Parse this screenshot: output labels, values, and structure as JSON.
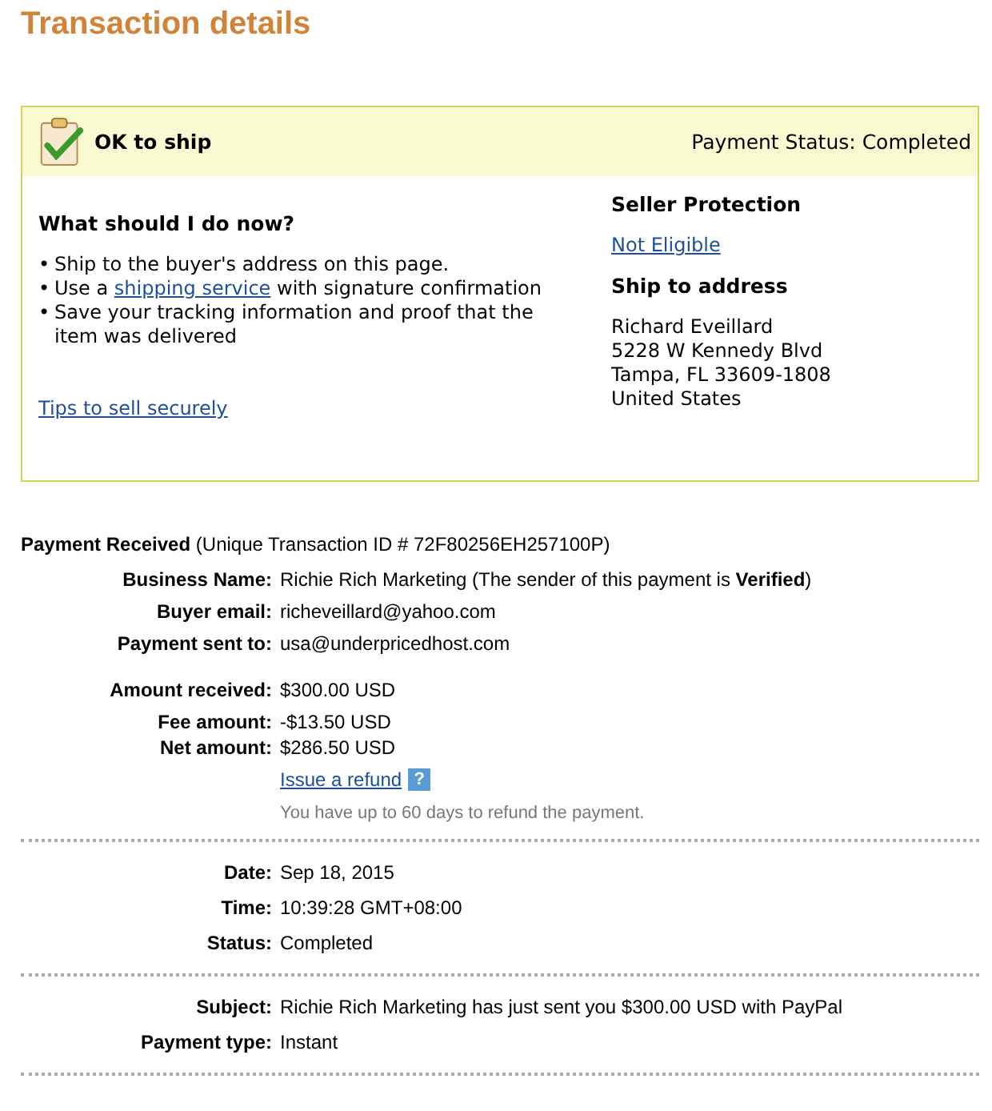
{
  "title": "Transaction details",
  "notice": {
    "status_label": "OK to ship",
    "payment_status": "Payment Status: Completed",
    "heading": "What should I do now?",
    "steps": [
      {
        "bullet": "•",
        "before": "Ship to the buyer's address on this page."
      },
      {
        "bullet": "•",
        "before": "Use a ",
        "link": "shipping service",
        "after": " with signature confirmation"
      },
      {
        "bullet": "•",
        "before": "Save your tracking information and proof that the item was delivered"
      }
    ],
    "tips_link": "Tips to sell securely",
    "protection_heading": "Seller Protection",
    "protection_link": "Not Eligible",
    "address_heading": "Ship to address",
    "address_lines": [
      "Richard Eveillard",
      "5228 W Kennedy Blvd",
      "Tampa, FL 33609-1808",
      "United States"
    ]
  },
  "payment": {
    "heading": "Payment Received",
    "transaction_id": "(Unique Transaction ID # 72F80256EH257100P)",
    "groups": [
      [
        {
          "label": "Business Name:",
          "value": "Richie Rich Marketing (The sender of this payment is **Verified**)"
        },
        {
          "label": "Buyer email:",
          "value": "richeveillard@yahoo.com"
        },
        {
          "label": "Payment sent to:",
          "value": "usa@underpricedhost.com"
        }
      ],
      [
        {
          "label": "Amount received:",
          "value": "$300.00 USD"
        }
      ],
      [
        {
          "label": "Fee amount:",
          "value": "-$13.50 USD"
        },
        {
          "label": "Net amount:",
          "value": "$286.50 USD"
        }
      ]
    ],
    "refund_link": "Issue a refund",
    "help_icon": "?",
    "refund_note": "You have up to 60 days to refund the payment."
  },
  "sections": [
    [
      {
        "label": "Date:",
        "value": "Sep 18, 2015"
      },
      {
        "label": "Time:",
        "value": "10:39:28 GMT+08:00"
      },
      {
        "label": "Status:",
        "value": "Completed"
      }
    ],
    [
      {
        "label": "Subject:",
        "value": "Richie Rich Marketing has just sent you $300.00 USD with PayPal"
      },
      {
        "label": "Payment type:",
        "value": "Instant"
      }
    ]
  ]
}
